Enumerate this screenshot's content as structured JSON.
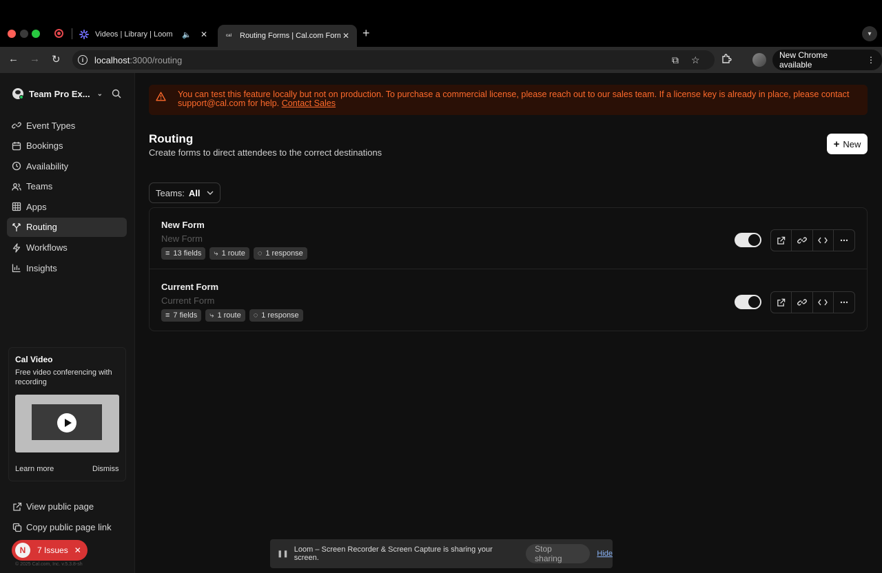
{
  "browser": {
    "tabs": [
      {
        "title": "Videos | Library | Loom",
        "active": false
      },
      {
        "title": "Routing Forms | Cal.com Form",
        "active": true
      }
    ],
    "tab_favicon_text": "cal",
    "url_host": "localhost",
    "url_path": ":3000/routing",
    "update_label": "New Chrome available"
  },
  "sidebar": {
    "team_name": "Team Pro Ex...",
    "items": [
      {
        "label": "Event Types",
        "icon": "link-icon"
      },
      {
        "label": "Bookings",
        "icon": "calendar-icon"
      },
      {
        "label": "Availability",
        "icon": "clock-icon"
      },
      {
        "label": "Teams",
        "icon": "users-icon"
      },
      {
        "label": "Apps",
        "icon": "grid-icon"
      },
      {
        "label": "Routing",
        "icon": "split-icon",
        "active": true
      },
      {
        "label": "Workflows",
        "icon": "zap-icon"
      },
      {
        "label": "Insights",
        "icon": "chart-icon"
      }
    ],
    "promo": {
      "title": "Cal Video",
      "description": "Free video conferencing with recording",
      "learn_more": "Learn more",
      "dismiss": "Dismiss"
    },
    "view_public": "View public page",
    "copy_link": "Copy public page link",
    "issues_badge": "N",
    "issues_label": "7 Issues",
    "version": "© 2025 Cal.com, Inc. v.5.3.8-sh"
  },
  "banner": {
    "text": "You can test this feature locally but not on production. To purchase a commercial license, please reach out to our sales team. If a license key is already in place, please contact support@cal.com for help.",
    "link": "Contact Sales"
  },
  "header": {
    "title": "Routing",
    "subtitle": "Create forms to direct attendees to the correct destinations",
    "new_button": "New"
  },
  "filter": {
    "label": "Teams:",
    "value": "All"
  },
  "forms": [
    {
      "name": "New Form",
      "description": "New Form",
      "fields": "13 fields",
      "routes": "1 route",
      "responses": "1 response",
      "enabled": true
    },
    {
      "name": "Current Form",
      "description": "Current Form",
      "fields": "7 fields",
      "routes": "1 route",
      "responses": "1 response",
      "enabled": true
    }
  ],
  "share_bar": {
    "message": "Loom – Screen Recorder & Screen Capture is sharing your screen.",
    "stop": "Stop sharing",
    "hide": "Hide"
  },
  "colors": {
    "banner_text": "#ff6a2b",
    "issues_bg": "#d83434",
    "accent_white": "#ffffff"
  }
}
